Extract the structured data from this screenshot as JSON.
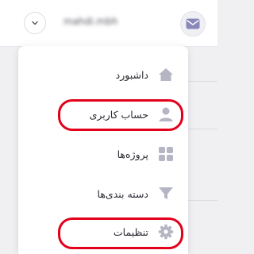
{
  "header": {
    "username": "mahdi.mbh"
  },
  "menu": {
    "items": [
      {
        "label": "داشبورد",
        "icon": "home-icon"
      },
      {
        "label": "حساب کاربری",
        "icon": "user-icon",
        "highlighted": true
      },
      {
        "label": "پروژه‌ها",
        "icon": "grid-icon"
      },
      {
        "label": "دسته بندی‌ها",
        "icon": "funnel-icon"
      },
      {
        "label": "تنظیمات",
        "icon": "gear-icon",
        "highlighted": true
      }
    ]
  },
  "colors": {
    "icon": "#b5b5c3",
    "highlight": "#e3001b",
    "accent": "#8a88b8"
  }
}
